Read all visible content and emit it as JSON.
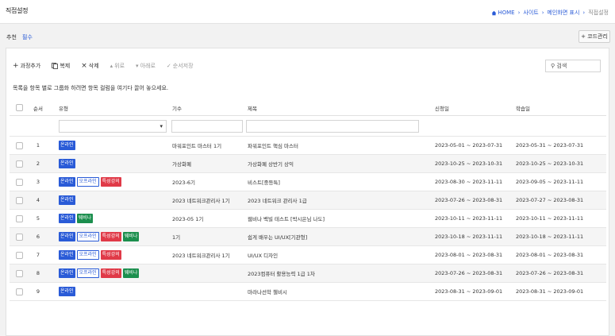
{
  "header": {
    "title": "직접설정",
    "breadcrumb": [
      "HOME",
      "사이트",
      "메인화면 표시",
      "직접설정"
    ]
  },
  "tabs": [
    {
      "label": "추천",
      "active": false
    },
    {
      "label": "필수",
      "active": true
    }
  ],
  "code_button": "+ 코드관리",
  "toolbar": {
    "add": "과정추가",
    "copy": "복제",
    "delete": "삭제",
    "up": "위로",
    "down": "아래로",
    "save_order": "순서저장"
  },
  "search": {
    "label": "검색"
  },
  "group_hint": "목록을 항목 별로 그룹화 하려면 항목 컬럼을 여기다 끌어 놓으세요.",
  "columns": {
    "order": "순서",
    "type": "유형",
    "gisu": "기수",
    "title": "제목",
    "apply": "신청일",
    "edu": "학습일"
  },
  "tag_labels": {
    "online": "온라인",
    "offline": "오프라인",
    "premium": "특성강의",
    "webinar": "웨비나"
  },
  "colors": {
    "online": "#2a5bd7",
    "premium": "#e03a48",
    "webinar": "#1c8f4e",
    "link": "#2a5bd7"
  },
  "rows": [
    {
      "no": "1",
      "tags": [
        "online"
      ],
      "gisu": "마워포인트 마스터 1기",
      "title": "파워포인트 핵심 마스터",
      "apply": "2023-05-01 ~ 2023-07-31",
      "edu": "2023-05-31 ~ 2023-07-31"
    },
    {
      "no": "2",
      "tags": [
        "online"
      ],
      "gisu": "가상화폐",
      "title": "가상화폐 상반기 상익",
      "apply": "2023-10-25 ~ 2023-10-31",
      "edu": "2023-10-25 ~ 2023-10-31"
    },
    {
      "no": "3",
      "tags": [
        "online",
        "offline",
        "premium"
      ],
      "gisu": "2023-6기",
      "title": "비스트[중등특]",
      "apply": "2023-08-30 ~ 2023-11-11",
      "edu": "2023-09-05 ~ 2023-11-11"
    },
    {
      "no": "4",
      "tags": [
        "online"
      ],
      "gisu": "2023 네트워크관리사 1기",
      "title": "2023 네트워크 관리사 1급",
      "apply": "2023-07-26 ~ 2023-08-31",
      "edu": "2023-07-27 ~ 2023-08-31"
    },
    {
      "no": "5",
      "tags": [
        "online",
        "webinar"
      ],
      "gisu": "2023-05 1기",
      "title": "웹비나 백빌 테스트 [박시은님 나도]",
      "apply": "2023-10-11 ~ 2023-11-11",
      "edu": "2023-10-11 ~ 2023-11-11"
    },
    {
      "no": "6",
      "tags": [
        "online",
        "offline",
        "premium",
        "webinar"
      ],
      "gisu": "1기",
      "title": "쉽게 배우는 UI/UX[기관형]",
      "apply": "2023-10-18 ~ 2023-11-11",
      "edu": "2023-10-18 ~ 2023-11-11"
    },
    {
      "no": "7",
      "tags": [
        "online",
        "offline",
        "premium"
      ],
      "gisu": "2023 네트워크관리사 1기",
      "title": "UI/UX 디자인",
      "apply": "2023-08-01 ~ 2023-08-31",
      "edu": "2023-08-01 ~ 2023-08-31"
    },
    {
      "no": "8",
      "tags": [
        "online",
        "offline",
        "premium",
        "webinar"
      ],
      "gisu": "",
      "title": "2023컴퓨터 활용능력 1급 1차",
      "apply": "2023-07-26 ~ 2023-08-31",
      "edu": "2023-07-26 ~ 2023-08-31"
    },
    {
      "no": "9",
      "tags": [
        "online"
      ],
      "gisu": "",
      "title": "마라나선학 챌비시",
      "apply": "2023-08-31 ~ 2023-09-01",
      "edu": "2023-08-31 ~ 2023-09-01"
    }
  ]
}
